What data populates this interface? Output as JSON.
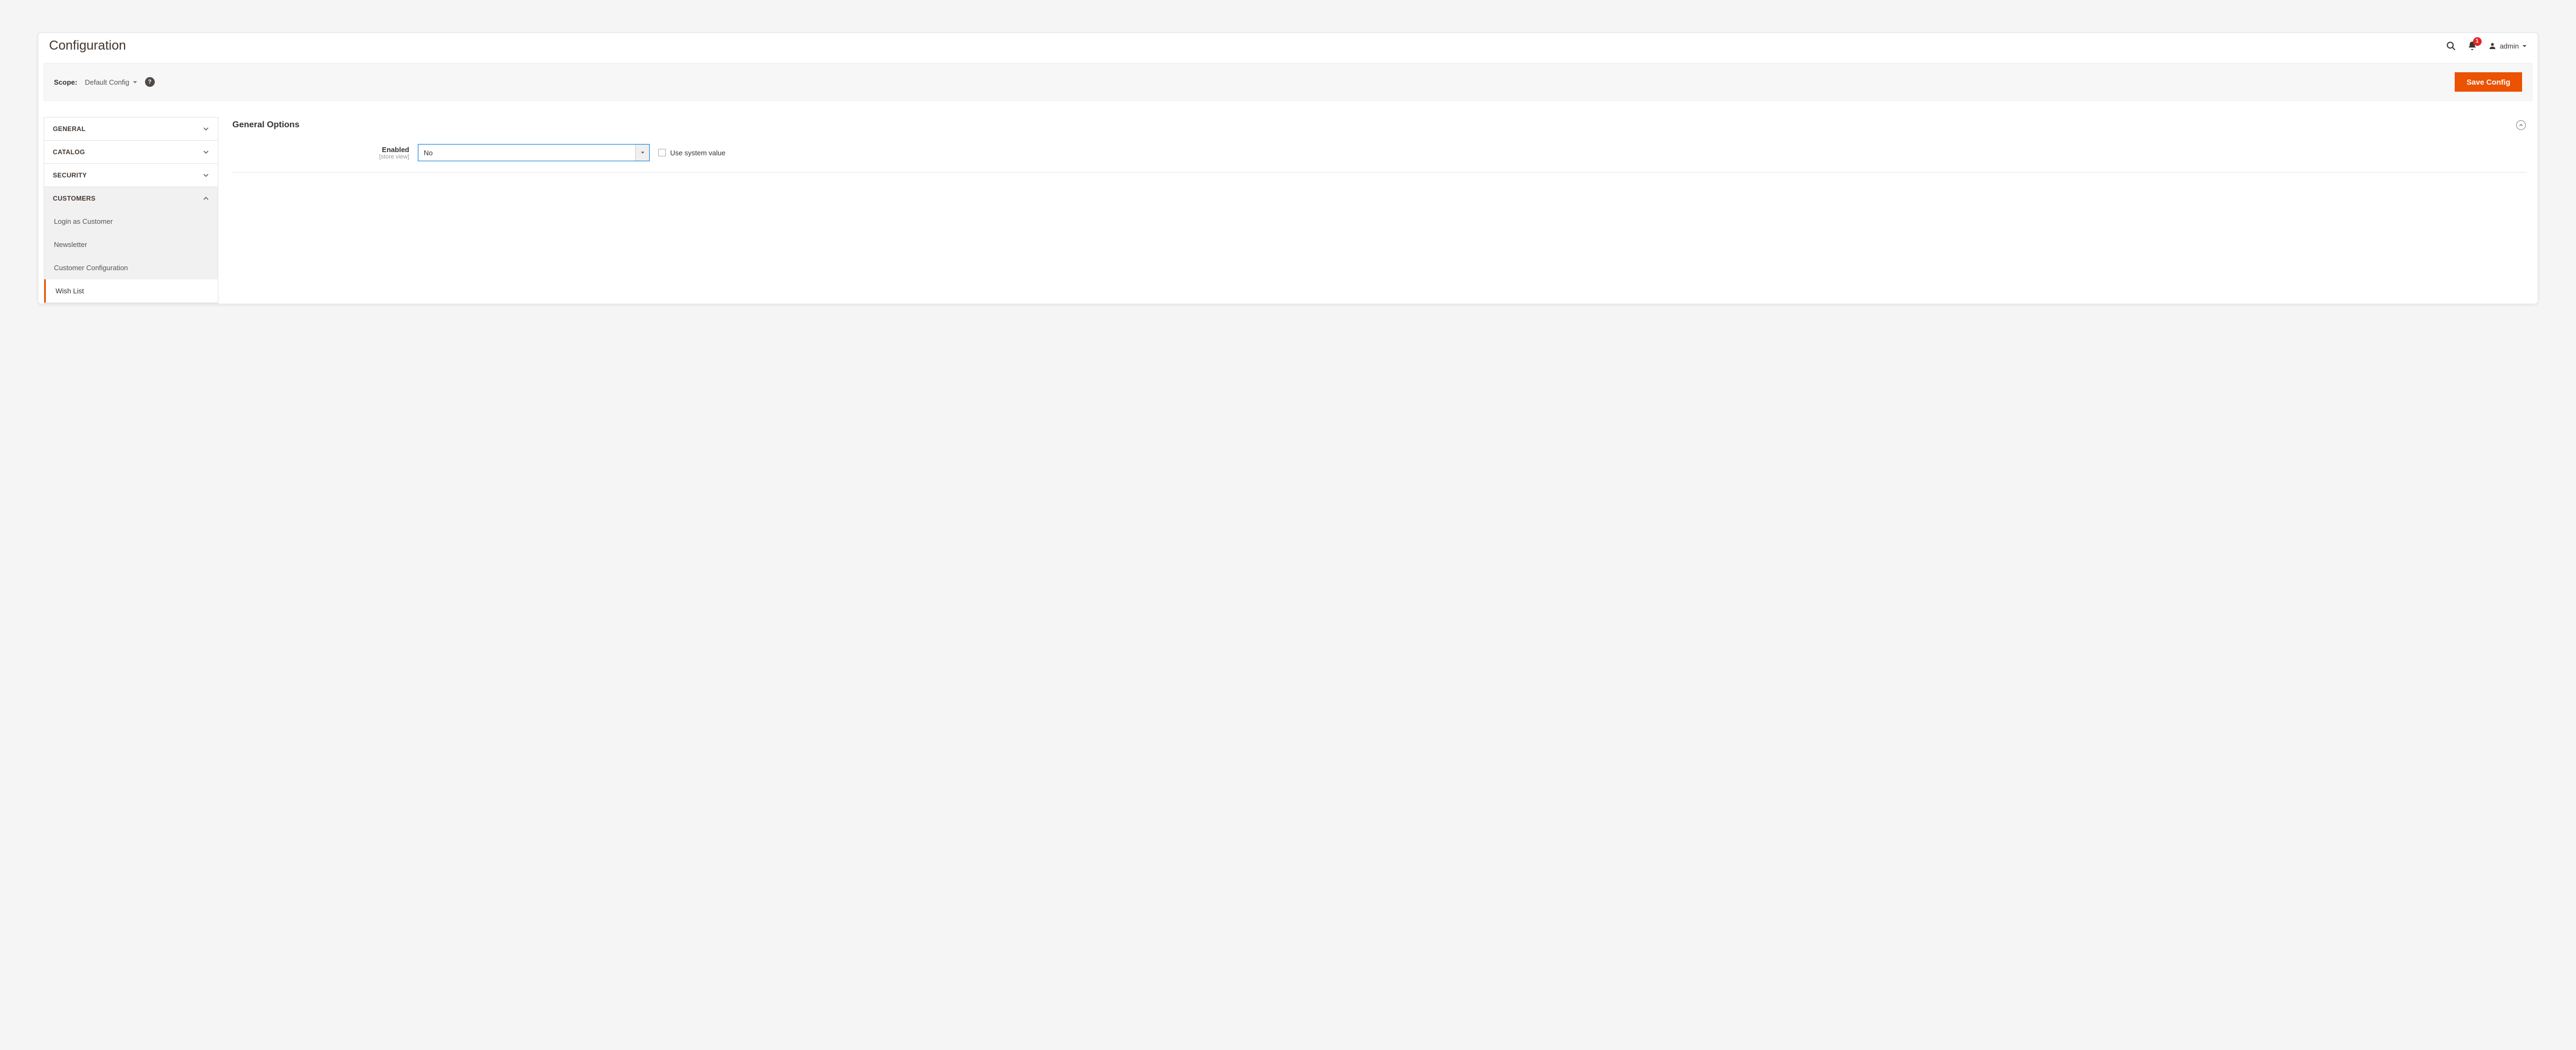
{
  "header": {
    "title": "Configuration",
    "notification_count": "1",
    "user_name": "admin"
  },
  "scope": {
    "label": "Scope:",
    "value": "Default Config",
    "save_button": "Save Config"
  },
  "sidebar": {
    "sections": [
      {
        "label": "General",
        "expanded": false
      },
      {
        "label": "Catalog",
        "expanded": false
      },
      {
        "label": "Security",
        "expanded": false
      },
      {
        "label": "Customers",
        "expanded": true
      }
    ],
    "customers_items": [
      {
        "label": "Login as Customer",
        "active": false
      },
      {
        "label": "Newsletter",
        "active": false
      },
      {
        "label": "Customer Configuration",
        "active": false
      },
      {
        "label": "Wish List",
        "active": true
      }
    ]
  },
  "main": {
    "section_title": "General Options",
    "field": {
      "label": "Enabled",
      "scope": "[store view]",
      "value": "No",
      "use_system_label": "Use system value"
    }
  }
}
